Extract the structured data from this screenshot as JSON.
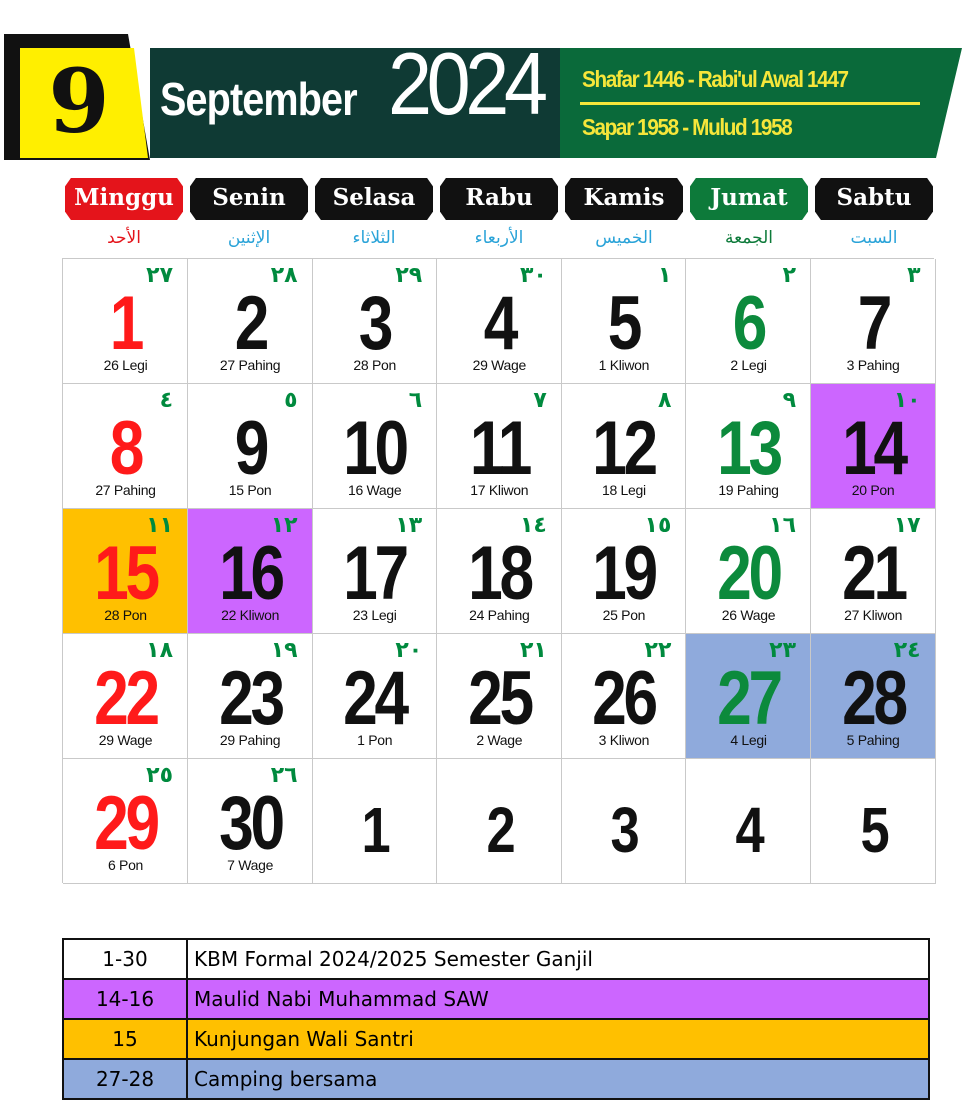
{
  "header": {
    "month_number": "9",
    "month_name": "September",
    "year": "2024",
    "hijri": "Shafar 1446 - Rabi'ul Awal 1447",
    "javanese": "Sapar 1958 - Mulud 1958",
    "colors": {
      "month_box": "#ffef00",
      "banner_dark": "#0f3a34",
      "banner_green": "#0a6a3a",
      "subtitle_text": "#f6e63a"
    }
  },
  "days": [
    {
      "label": "Minggu",
      "arabic": "الأحد",
      "color": "#e4141b",
      "arabic_color": "#e4141b"
    },
    {
      "label": "Senin",
      "arabic": "الإثنين",
      "color": "#111111",
      "arabic_color": "#2aa3d8"
    },
    {
      "label": "Selasa",
      "arabic": "الثلاثاء",
      "color": "#111111",
      "arabic_color": "#2aa3d8"
    },
    {
      "label": "Rabu",
      "arabic": "الأربعاء",
      "color": "#111111",
      "arabic_color": "#2aa3d8"
    },
    {
      "label": "Kamis",
      "arabic": "الخميس",
      "color": "#111111",
      "arabic_color": "#2aa3d8"
    },
    {
      "label": "Jumat",
      "arabic": "الجمعة",
      "color": "#0d7a3a",
      "arabic_color": "#0d7a3a"
    },
    {
      "label": "Sabtu",
      "arabic": "السبت",
      "color": "#111111",
      "arabic_color": "#2aa3d8"
    }
  ],
  "calendar": {
    "weeks": [
      [
        {
          "day": "1",
          "hijri": "٢٧",
          "pasaran": "26 Legi",
          "color": "red"
        },
        {
          "day": "2",
          "hijri": "٢٨",
          "pasaran": "27 Pahing",
          "color": "black"
        },
        {
          "day": "3",
          "hijri": "٢٩",
          "pasaran": "28 Pon",
          "color": "black"
        },
        {
          "day": "4",
          "hijri": "٣٠",
          "pasaran": "29 Wage",
          "color": "black"
        },
        {
          "day": "5",
          "hijri": "١",
          "pasaran": "1 Kliwon",
          "color": "black"
        },
        {
          "day": "6",
          "hijri": "٢",
          "pasaran": "2 Legi",
          "color": "green"
        },
        {
          "day": "7",
          "hijri": "٣",
          "pasaran": "3 Pahing",
          "color": "black"
        }
      ],
      [
        {
          "day": "8",
          "hijri": "٤",
          "pasaran": "27 Pahing",
          "color": "red"
        },
        {
          "day": "9",
          "hijri": "٥",
          "pasaran": "15 Pon",
          "color": "black"
        },
        {
          "day": "10",
          "hijri": "٦",
          "pasaran": "16 Wage",
          "color": "black"
        },
        {
          "day": "11",
          "hijri": "٧",
          "pasaran": "17 Kliwon",
          "color": "black"
        },
        {
          "day": "12",
          "hijri": "٨",
          "pasaran": "18 Legi",
          "color": "black"
        },
        {
          "day": "13",
          "hijri": "٩",
          "pasaran": "19 Pahing",
          "color": "green"
        },
        {
          "day": "14",
          "hijri": "١٠",
          "pasaran": "20 Pon",
          "color": "black",
          "highlight": "#cc66ff"
        }
      ],
      [
        {
          "day": "15",
          "hijri": "١١",
          "pasaran": "28 Pon",
          "color": "red",
          "highlight": "#ffc000"
        },
        {
          "day": "16",
          "hijri": "١٢",
          "pasaran": "22 Kliwon",
          "color": "black",
          "highlight": "#cc66ff"
        },
        {
          "day": "17",
          "hijri": "١٣",
          "pasaran": "23 Legi",
          "color": "black"
        },
        {
          "day": "18",
          "hijri": "١٤",
          "pasaran": "24 Pahing",
          "color": "black"
        },
        {
          "day": "19",
          "hijri": "١٥",
          "pasaran": "25 Pon",
          "color": "black"
        },
        {
          "day": "20",
          "hijri": "١٦",
          "pasaran": "26 Wage",
          "color": "green"
        },
        {
          "day": "21",
          "hijri": "١٧",
          "pasaran": "27 Kliwon",
          "color": "black"
        }
      ],
      [
        {
          "day": "22",
          "hijri": "١٨",
          "pasaran": "29 Wage",
          "color": "red"
        },
        {
          "day": "23",
          "hijri": "١٩",
          "pasaran": "29 Pahing",
          "color": "black"
        },
        {
          "day": "24",
          "hijri": "٢٠",
          "pasaran": "1 Pon",
          "color": "black"
        },
        {
          "day": "25",
          "hijri": "٢١",
          "pasaran": "2 Wage",
          "color": "black"
        },
        {
          "day": "26",
          "hijri": "٢٢",
          "pasaran": "3 Kliwon",
          "color": "black"
        },
        {
          "day": "27",
          "hijri": "٢٣",
          "pasaran": "4 Legi",
          "color": "green",
          "highlight": "#8faadc"
        },
        {
          "day": "28",
          "hijri": "٢٤",
          "pasaran": "5 Pahing",
          "color": "black",
          "highlight": "#8faadc"
        }
      ],
      [
        {
          "day": "29",
          "hijri": "٢٥",
          "pasaran": "6  Pon",
          "color": "red"
        },
        {
          "day": "30",
          "hijri": "٢٦",
          "pasaran": "7  Wage",
          "color": "black"
        },
        {
          "day": "1",
          "hijri": "",
          "pasaran": "",
          "color": "black"
        },
        {
          "day": "2",
          "hijri": "",
          "pasaran": "",
          "color": "black"
        },
        {
          "day": "3",
          "hijri": "",
          "pasaran": "",
          "color": "black"
        },
        {
          "day": "4",
          "hijri": "",
          "pasaran": "",
          "color": "black"
        },
        {
          "day": "5",
          "hijri": "",
          "pasaran": "",
          "color": "black"
        }
      ]
    ]
  },
  "legend": [
    {
      "range": "1-30",
      "text": "KBM Formal 2024/2025 Semester Ganjil",
      "color": "#ffffff"
    },
    {
      "range": "14-16",
      "text": "Maulid Nabi Muhammad SAW",
      "color": "#cc66ff"
    },
    {
      "range": "15",
      "text": "Kunjungan Wali Santri",
      "color": "#ffc000"
    },
    {
      "range": "27-28",
      "text": "Camping bersama",
      "color": "#8faadc"
    }
  ]
}
